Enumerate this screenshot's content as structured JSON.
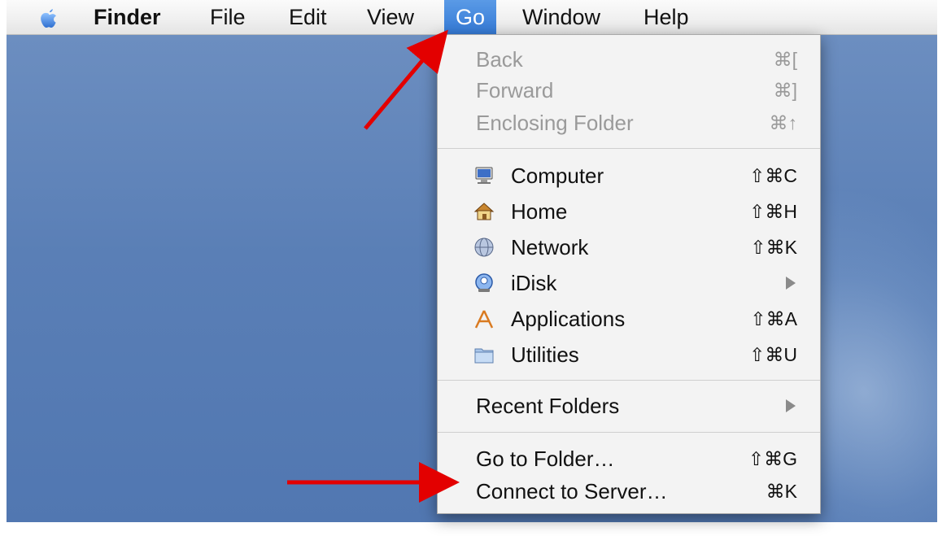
{
  "menubar": {
    "items": [
      {
        "label": "Finder"
      },
      {
        "label": "File"
      },
      {
        "label": "Edit"
      },
      {
        "label": "View"
      },
      {
        "label": "Go"
      },
      {
        "label": "Window"
      },
      {
        "label": "Help"
      }
    ],
    "active_color": "#3479d5"
  },
  "go_menu": {
    "sections": [
      {
        "items": [
          {
            "label": "Back",
            "shortcut": "⌘[",
            "disabled": true
          },
          {
            "label": "Forward",
            "shortcut": "⌘]",
            "disabled": true
          },
          {
            "label": "Enclosing Folder",
            "shortcut": "⌘↑",
            "disabled": true
          }
        ]
      },
      {
        "items": [
          {
            "label": "Computer",
            "shortcut": "⇧⌘C",
            "icon": "computer-icon"
          },
          {
            "label": "Home",
            "shortcut": "⇧⌘H",
            "icon": "home-icon"
          },
          {
            "label": "Network",
            "shortcut": "⇧⌘K",
            "icon": "network-icon"
          },
          {
            "label": "iDisk",
            "submenu": true,
            "icon": "idisk-icon"
          },
          {
            "label": "Applications",
            "shortcut": "⇧⌘A",
            "icon": "applications-icon"
          },
          {
            "label": "Utilities",
            "shortcut": "⇧⌘U",
            "icon": "utilities-folder-icon"
          }
        ]
      },
      {
        "items": [
          {
            "label": "Recent Folders",
            "submenu": true
          }
        ]
      },
      {
        "items": [
          {
            "label": "Go to Folder…",
            "shortcut": "⇧⌘G"
          },
          {
            "label": "Connect to Server…",
            "shortcut": "⌘K"
          }
        ]
      }
    ]
  },
  "annotations": {
    "arrow_color": "#e30000"
  }
}
